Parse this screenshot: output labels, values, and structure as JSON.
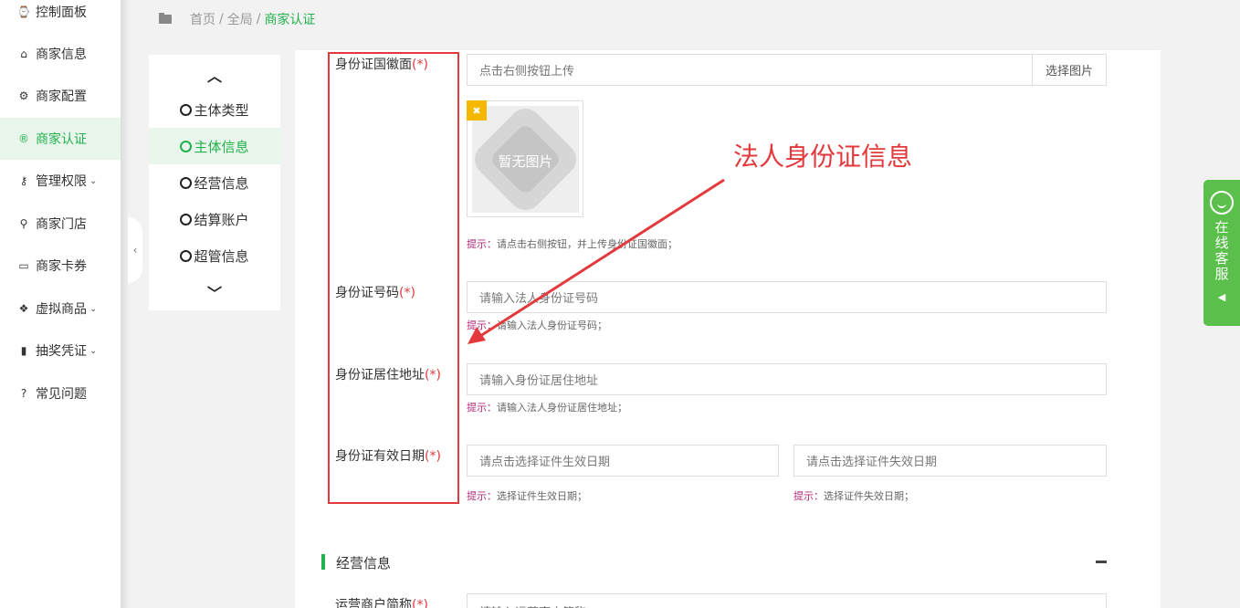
{
  "sidebar": {
    "items": [
      {
        "label": "控制面板",
        "icon": "dashboard-icon",
        "glyph": "⌚",
        "caret": ""
      },
      {
        "label": "商家信息",
        "icon": "home-icon",
        "glyph": "⌂",
        "caret": ""
      },
      {
        "label": "商家配置",
        "icon": "gears-icon",
        "glyph": "⚙",
        "caret": ""
      },
      {
        "label": "商家认证",
        "icon": "registered-icon",
        "glyph": "®",
        "caret": "",
        "active": true
      },
      {
        "label": "管理权限",
        "icon": "key-icon",
        "glyph": "⚷",
        "caret": "⌄"
      },
      {
        "label": "商家门店",
        "icon": "map-marker-icon",
        "glyph": "⚲",
        "caret": ""
      },
      {
        "label": "商家卡券",
        "icon": "credit-card-icon",
        "glyph": "▭",
        "caret": ""
      },
      {
        "label": "虚拟商品",
        "icon": "dropbox-icon",
        "glyph": "❖",
        "caret": "⌄"
      },
      {
        "label": "抽奖凭证",
        "icon": "bookmark-icon",
        "glyph": "▮",
        "caret": "⌄"
      },
      {
        "label": "常见问题",
        "icon": "question-circle-icon",
        "glyph": "?",
        "caret": ""
      }
    ]
  },
  "breadcrumb": {
    "home": "首页",
    "sep": "/",
    "global": "全局",
    "current": "商家认证"
  },
  "steps": {
    "up_glyph": "︿",
    "down_glyph": "﹀",
    "items": [
      "主体类型",
      "主体信息",
      "经营信息",
      "结算账户",
      "超管信息"
    ],
    "active_index": 1
  },
  "form": {
    "emblem": {
      "label": "身份证国徽面",
      "required": "(*)",
      "placeholder": "点击右侧按钮上传",
      "button": "选择图片",
      "no_image": "暂无图片",
      "hint_prefix": "提示：",
      "hint": "请点击右侧按钮，并上传身份证国徽面；"
    },
    "id_number": {
      "label": "身份证号码",
      "required": "(*)",
      "placeholder": "请输入法人身份证号码",
      "hint_prefix": "提示：",
      "hint": "请输入法人身份证号码；"
    },
    "address": {
      "label": "身份证居住地址",
      "required": "(*)",
      "placeholder": "请输入身份证居住地址",
      "hint_prefix": "提示：",
      "hint": "请输入法人身份证居住地址；"
    },
    "validity": {
      "label": "身份证有效日期",
      "required": "(*)",
      "start_placeholder": "请点击选择证件生效日期",
      "end_placeholder": "请点击选择证件失效日期",
      "hint_prefix": "提示：",
      "start_hint": "选择证件生效日期；",
      "end_hint": "选择证件失效日期；"
    },
    "next_section": {
      "title": "经营信息",
      "toggle": "−",
      "partial_label": "运营商户简称",
      "required": "(*)",
      "partial_placeholder": "请输入运营商户简称"
    }
  },
  "annotation": {
    "text": "法人身份证信息",
    "color": "#e4393c"
  },
  "service": {
    "text": "在线客服",
    "arrow": "◀"
  },
  "colors": {
    "accent": "#23b14d",
    "annotation_red": "#e4393c",
    "hint": "#b32a7a",
    "service": "#5bbf4c"
  }
}
